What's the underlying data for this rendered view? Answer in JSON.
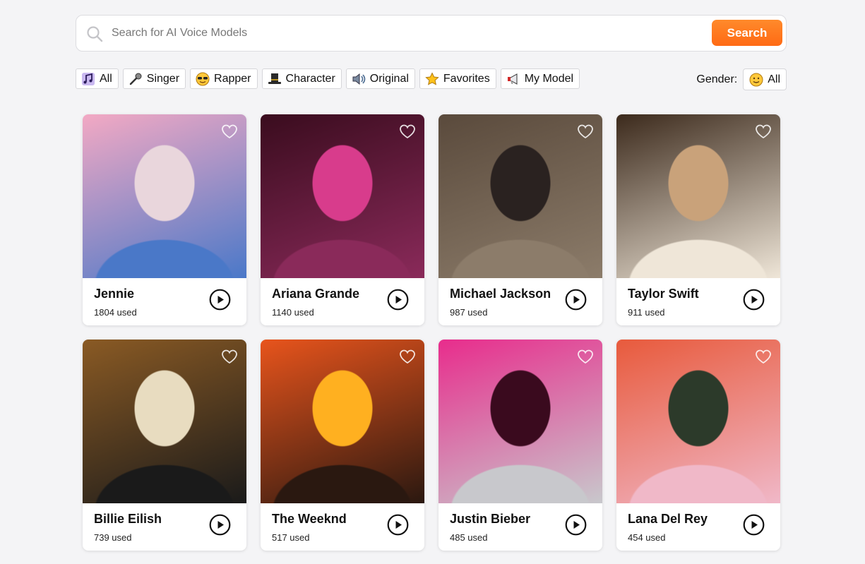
{
  "search": {
    "placeholder": "Search for AI Voice Models",
    "button_label": "Search"
  },
  "filters": [
    {
      "label": "All",
      "icon": "music-note-icon"
    },
    {
      "label": "Singer",
      "icon": "microphone-icon"
    },
    {
      "label": "Rapper",
      "icon": "sunglasses-face-icon"
    },
    {
      "label": "Character",
      "icon": "top-hat-icon"
    },
    {
      "label": "Original",
      "icon": "speaker-icon"
    },
    {
      "label": "Favorites",
      "icon": "star-icon"
    },
    {
      "label": "My Model",
      "icon": "megaphone-icon"
    }
  ],
  "gender": {
    "label": "Gender:",
    "value": "All",
    "icon": "smiley-face-icon"
  },
  "models": [
    {
      "name": "Jennie",
      "used": "1804 used",
      "palette": [
        "#f3a9c4",
        "#e9d6dc",
        "#4a78c8"
      ]
    },
    {
      "name": "Ariana Grande",
      "used": "1140 used",
      "palette": [
        "#3a0c1e",
        "#d83c8c",
        "#8a2a5a"
      ]
    },
    {
      "name": "Michael Jackson",
      "used": "987 used",
      "palette": [
        "#5a4a3c",
        "#2a2220",
        "#8c7c6a"
      ]
    },
    {
      "name": "Taylor Swift",
      "used": "911 used",
      "palette": [
        "#3c2a1c",
        "#c9a27a",
        "#efe6d8"
      ]
    },
    {
      "name": "Billie Eilish",
      "used": "739 used",
      "palette": [
        "#8a5a24",
        "#e8dcc0",
        "#1a1a1a"
      ]
    },
    {
      "name": "The Weeknd",
      "used": "517 used",
      "palette": [
        "#e8541c",
        "#ffb020",
        "#2a1810"
      ]
    },
    {
      "name": "Justin Bieber",
      "used": "485 used",
      "palette": [
        "#e82c8c",
        "#3a0a1e",
        "#c8c8cc"
      ]
    },
    {
      "name": "Lana Del Rey",
      "used": "454 used",
      "palette": [
        "#e85a3c",
        "#2c3a2a",
        "#f0b8c8"
      ]
    }
  ]
}
